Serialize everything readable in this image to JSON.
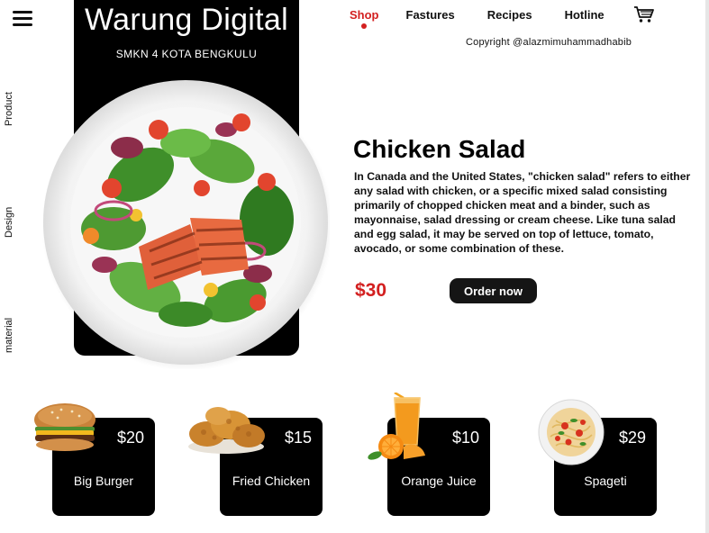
{
  "brand": {
    "title": "Warung Digital",
    "subtitle": "SMKN 4 KOTA BENGKULU"
  },
  "nav": {
    "items": [
      "Shop",
      "Fastures",
      "Recipes",
      "Hotline"
    ],
    "active": "Shop",
    "cart_icon": "cart-icon"
  },
  "copyright": "Copyright @alazmimuhammadhabib",
  "sidebar": {
    "items": [
      "Product",
      "Design",
      "material"
    ]
  },
  "featured": {
    "title": "Chicken Salad",
    "description": "In Canada and the United States, \"chicken salad\" refers to either any salad with chicken, or a specific mixed salad consisting primarily of chopped chicken meat and a binder, such as mayonnaise, salad dressing or cream cheese. Like tuna salad and egg salad, it may be served on top of lettuce, tomato, avocado, or some combination of these.",
    "price": "$30",
    "order_label": "Order now"
  },
  "menu": [
    {
      "name": "Big Burger",
      "price": "$20",
      "icon": "burger"
    },
    {
      "name": "Fried Chicken",
      "price": "$15",
      "icon": "fried-chicken"
    },
    {
      "name": "Orange Juice",
      "price": "$10",
      "icon": "orange-juice"
    },
    {
      "name": "Spageti",
      "price": "$29",
      "icon": "spaghetti"
    }
  ],
  "colors": {
    "accent": "#d32020",
    "dark": "#000000",
    "background": "#ffffff"
  }
}
